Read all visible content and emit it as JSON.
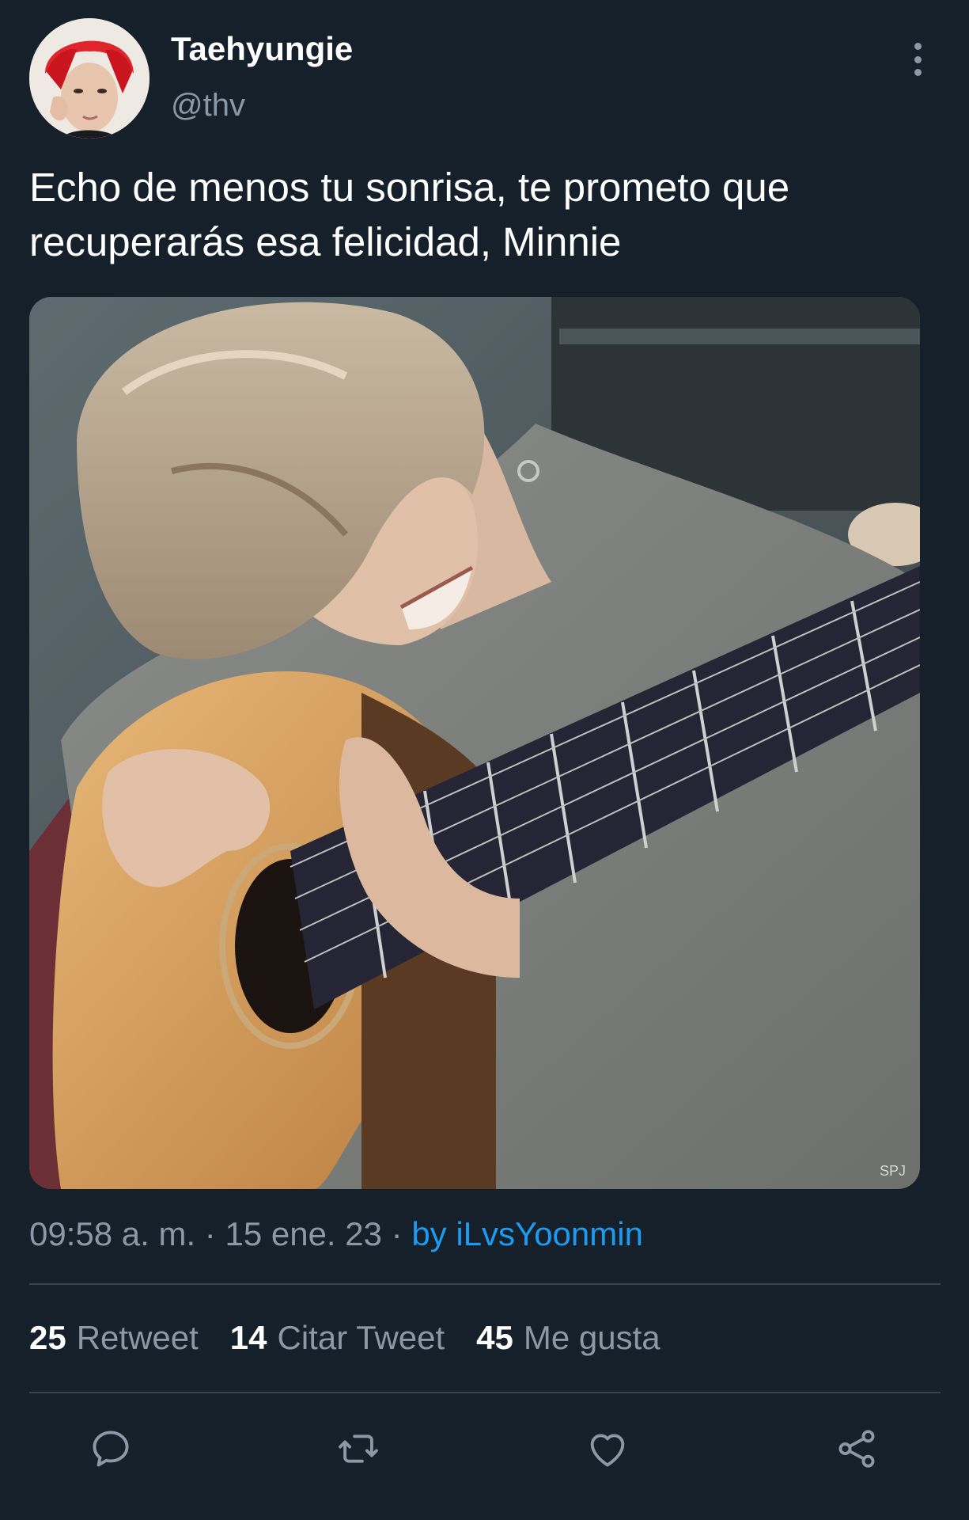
{
  "tweet": {
    "display_name": "Taehyungie",
    "handle": "@thv",
    "text": "Echo de menos tu sonrisa, te prometo que recuperarás esa felicidad, Minnie",
    "time": "09:58 a. m.",
    "separator": "·",
    "date": "15 ene. 23",
    "source": "by iLvsYoonmin",
    "media_watermark": "SPJ"
  },
  "stats": [
    {
      "count": "25",
      "label": "Retweet"
    },
    {
      "count": "14",
      "label": "Citar Tweet"
    },
    {
      "count": "45",
      "label": "Me gusta"
    }
  ],
  "actions": [
    "reply-icon",
    "retweet-icon",
    "like-icon",
    "share-icon"
  ],
  "colors": {
    "background": "#15202b",
    "text": "#ffffff",
    "secondary": "#8b98a5",
    "link": "#1d9bf0",
    "divider": "#38444d"
  }
}
